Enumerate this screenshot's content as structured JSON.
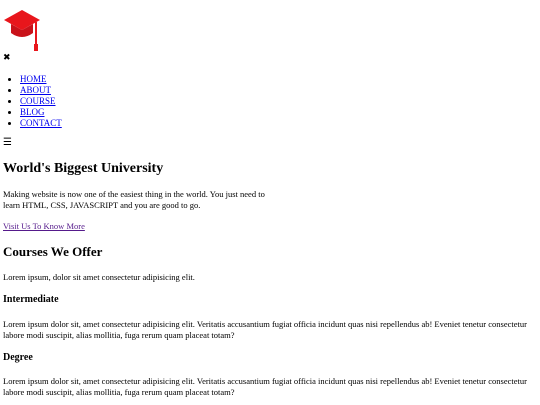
{
  "logo": {
    "icon": "graduation-cap-icon",
    "color": "#e8161c"
  },
  "nav": {
    "close_icon": "close-icon",
    "close_glyph": "✖",
    "menu_icon": "hamburger-menu-icon",
    "menu_glyph": "☰",
    "items": [
      {
        "label": "HOME"
      },
      {
        "label": "ABOUT"
      },
      {
        "label": "COURSE"
      },
      {
        "label": "BLOG"
      },
      {
        "label": "CONTACT"
      }
    ]
  },
  "hero": {
    "title": "World's Biggest University",
    "text": "Making website is now one of the easiest thing in the world. You just need to learn HTML, CSS, JAVASCRIPT and you are good to go.",
    "link_label": "Visit Us To Know More"
  },
  "courses": {
    "title": "Courses We Offer",
    "intro": "Lorem ipsum, dolor sit amet consectetur adipisicing elit.",
    "items": [
      {
        "title": "Intermediate",
        "text": "Lorem ipsum dolor sit, amet consectetur adipisicing elit. Veritatis accusantium fugiat officia incidunt quas nisi repellendus ab! Eveniet tenetur consectetur labore modi suscipit, alias mollitia, fuga rerum quam placeat totam?"
      },
      {
        "title": "Degree",
        "text": "Lorem ipsum dolor sit, amet consectetur adipisicing elit. Veritatis accusantium fugiat officia incidunt quas nisi repellendus ab! Eveniet tenetur consectetur labore modi suscipit, alias mollitia, fuga rerum quam placeat totam?"
      }
    ]
  }
}
